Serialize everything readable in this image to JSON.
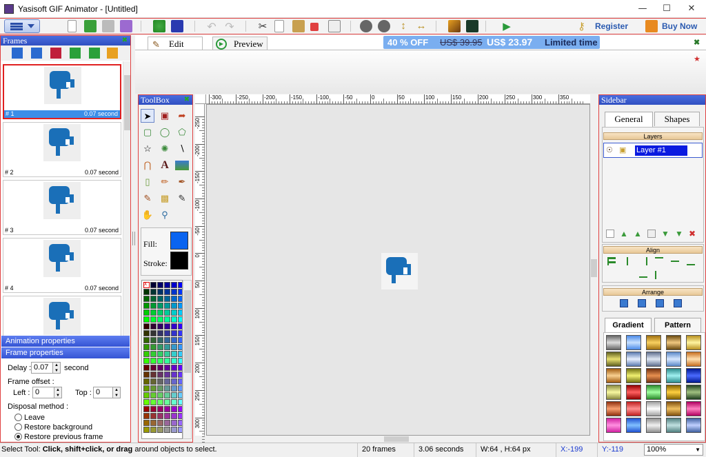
{
  "window": {
    "title": "Yasisoft GIF Animator - [Untitled]"
  },
  "toolbar": {
    "register": "Register",
    "buy_now": "Buy Now"
  },
  "promo": {
    "discount": "40 % OFF",
    "old_price": "US$ 39.95",
    "new_price": "US$ 23.97",
    "note": "Limited time"
  },
  "frames_panel": {
    "title": "Frames",
    "frames": [
      {
        "index": "# 1",
        "time": "0.07 second"
      },
      {
        "index": "# 2",
        "time": "0.07 second"
      },
      {
        "index": "# 3",
        "time": "0.07 second"
      },
      {
        "index": "# 4",
        "time": "0.07 second"
      }
    ]
  },
  "properties": {
    "animation_header": "Animation properties",
    "frame_header": "Frame properties",
    "delay_label": "Delay :",
    "delay_value": "0.07",
    "delay_unit": "second",
    "offset_label": "Frame offset :",
    "left_label": "Left :",
    "left_value": "0",
    "top_label": "Top :",
    "top_value": "0",
    "disposal_label": "Disposal method :",
    "disposal_options": [
      "Leave",
      "Restore background",
      "Restore previous frame"
    ],
    "disposal_selected": 2
  },
  "editor_tabs": {
    "edit": "Edit",
    "preview": "Preview"
  },
  "toolbox": {
    "title": "ToolBox",
    "fill_label": "Fill:",
    "stroke_label": "Stroke:",
    "fill_color": "#0a64f0",
    "stroke_color": "#000000"
  },
  "ruler_top": [
    "-300",
    "-250",
    "-200",
    "-150",
    "-100",
    "-50",
    "0",
    "50",
    "100",
    "150",
    "200",
    "250",
    "300",
    "350"
  ],
  "ruler_left": [
    "-250",
    "-200",
    "-150",
    "-100",
    "-50",
    "0",
    "50",
    "100",
    "150",
    "200",
    "250",
    "300"
  ],
  "sidebar": {
    "title": "Sidebar",
    "tabs": [
      "General",
      "Shapes"
    ],
    "layers_header": "Layers",
    "layer_name": "Layer #1",
    "align_header": "Align",
    "arrange_header": "Arrange",
    "lower_tabs": [
      "Gradient",
      "Pattern"
    ]
  },
  "status": {
    "hint_prefix": "Select Tool:",
    "hint_bold": "Click, shift+click, or drag",
    "hint_rest": "around objects to select.",
    "frames": "20 frames",
    "duration": "3.06 seconds",
    "size": "W:64 , H:64 px",
    "x": "X:-199",
    "y": "Y:-119",
    "zoom": "100%"
  }
}
